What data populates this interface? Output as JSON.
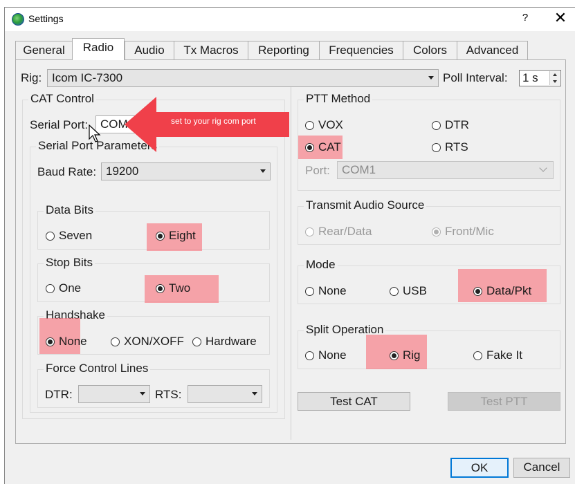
{
  "window": {
    "title": "Settings",
    "help": "?",
    "close": "✕"
  },
  "tabs": [
    "General",
    "Radio",
    "Audio",
    "Tx Macros",
    "Reporting",
    "Frequencies",
    "Colors",
    "Advanced"
  ],
  "active_tab": "Radio",
  "rig": {
    "label": "Rig:",
    "value": "Icom IC-7300"
  },
  "poll": {
    "label": "Poll Interval:",
    "value": "1 s"
  },
  "cat": {
    "title": "CAT Control",
    "serial_port_label": "Serial Port:",
    "serial_port_value": "COM1",
    "params_title": "Serial Port Parameters",
    "baud_label": "Baud Rate:",
    "baud_value": "19200",
    "data_bits": {
      "title": "Data Bits",
      "options": [
        "Seven",
        "Eight"
      ],
      "selected": "Eight"
    },
    "stop_bits": {
      "title": "Stop Bits",
      "options": [
        "One",
        "Two"
      ],
      "selected": "Two"
    },
    "handshake": {
      "title": "Handshake",
      "options": [
        "None",
        "XON/XOFF",
        "Hardware"
      ],
      "selected": "None"
    },
    "force": {
      "title": "Force Control Lines",
      "dtr_label": "DTR:",
      "rts_label": "RTS:",
      "dtr_value": "",
      "rts_value": ""
    }
  },
  "ptt": {
    "title": "PTT Method",
    "options": [
      "VOX",
      "DTR",
      "CAT",
      "RTS"
    ],
    "selected": "CAT",
    "port_label": "Port:",
    "port_value": "COM1"
  },
  "audio_source": {
    "title": "Transmit Audio Source",
    "options": [
      "Rear/Data",
      "Front/Mic"
    ],
    "selected": "Front/Mic"
  },
  "mode": {
    "title": "Mode",
    "options": [
      "None",
      "USB",
      "Data/Pkt"
    ],
    "selected": "Data/Pkt"
  },
  "split": {
    "title": "Split Operation",
    "options": [
      "None",
      "Rig",
      "Fake It"
    ],
    "selected": "Rig"
  },
  "buttons": {
    "test_cat": "Test CAT",
    "test_ptt": "Test PTT",
    "ok": "OK",
    "cancel": "Cancel"
  },
  "annotation": {
    "text": "set to your rig com port",
    "color": "#f0404a",
    "highlight_color": "#f86e78"
  }
}
